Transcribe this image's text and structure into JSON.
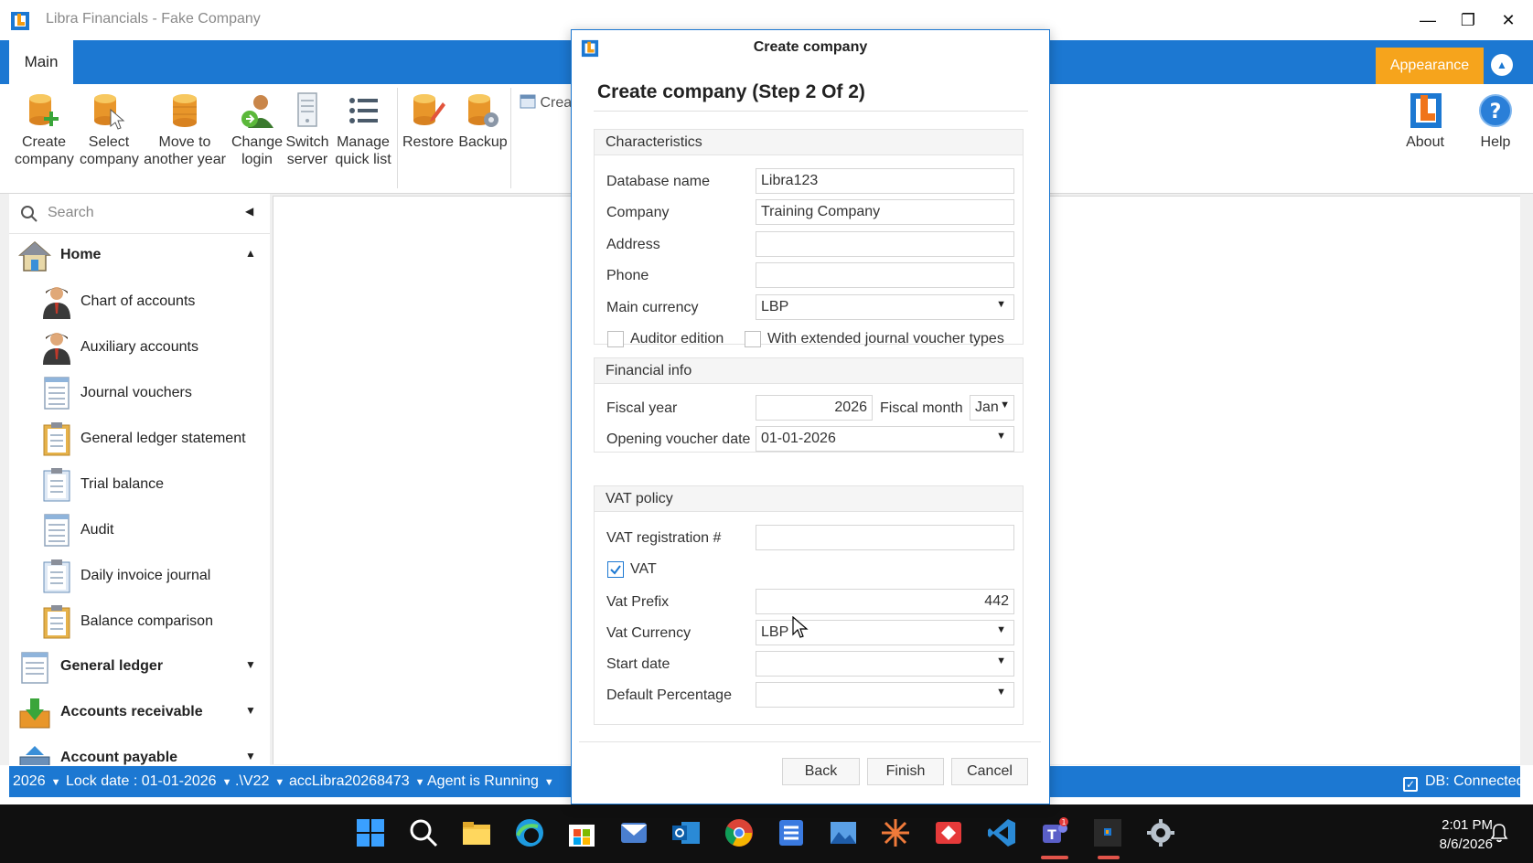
{
  "window": {
    "title": "Libra Financials - Fake Company",
    "minimize": "—",
    "restore": "❐",
    "close": "✕"
  },
  "ribbon": {
    "tab_main": "Main",
    "appearance": "Appearance",
    "collapse": "▲",
    "buttons": [
      {
        "line1": "Create",
        "line2": "company"
      },
      {
        "line1": "Select",
        "line2": "company"
      },
      {
        "line1": "Move to",
        "line2": "another year"
      },
      {
        "line1": "Change",
        "line2": "login"
      },
      {
        "line1": "Switch",
        "line2": "server"
      },
      {
        "line1": "Manage",
        "line2": "quick list"
      },
      {
        "line1": "Restore",
        "line2": ""
      },
      {
        "line1": "Backup",
        "line2": ""
      }
    ],
    "create_small": "Crea",
    "about": "About",
    "help": "Help"
  },
  "sidebar": {
    "search_placeholder": "Search",
    "collapse": "◀",
    "home": {
      "label": "Home",
      "arrow": "▲"
    },
    "items": [
      {
        "label": "Chart of accounts",
        "icon": "person-icon"
      },
      {
        "label": "Auxiliary accounts",
        "icon": "person-icon"
      },
      {
        "label": "Journal vouchers",
        "icon": "document-icon"
      },
      {
        "label": "General ledger statement",
        "icon": "clipboard-icon"
      },
      {
        "label": "Trial balance",
        "icon": "clipboard-icon"
      },
      {
        "label": "Audit",
        "icon": "document-icon"
      },
      {
        "label": "Daily invoice journal",
        "icon": "clipboard-icon"
      },
      {
        "label": "Balance comparison",
        "icon": "clipboard-icon"
      }
    ],
    "groups": [
      {
        "label": "General ledger",
        "arrow": "▼"
      },
      {
        "label": "Accounts receivable",
        "arrow": "▼"
      },
      {
        "label": "Account payable",
        "arrow": "▼"
      }
    ]
  },
  "statusbar": {
    "year": "2026",
    "lock_date": "Lock date : 01-01-2026",
    "server": ".\\V22",
    "database": "accLibra20268473",
    "agent": "Agent is Running",
    "db_status": "DB: Connected",
    "dropdown": "▼",
    "check": "✓"
  },
  "dialog": {
    "title": "Create company",
    "heading": "Create company (Step 2 Of 2)",
    "characteristics": {
      "header": "Characteristics",
      "database_name_label": "Database name",
      "database_name_value": "Libra123",
      "company_label": "Company",
      "company_value": "Training Company",
      "address_label": "Address",
      "address_value": "",
      "phone_label": "Phone",
      "phone_value": "",
      "main_currency_label": "Main currency",
      "main_currency_value": "LBP",
      "auditor_edition_label": "Auditor edition",
      "auditor_edition_checked": false,
      "extended_jv_label": "With extended journal voucher types",
      "extended_jv_checked": false
    },
    "financial": {
      "header": "Financial info",
      "fiscal_year_label": "Fiscal year",
      "fiscal_year_value": "2026",
      "fiscal_month_label": "Fiscal month",
      "fiscal_month_value": "Jan",
      "opening_voucher_label": "Opening voucher date",
      "opening_voucher_value": "01-01-2026"
    },
    "vat": {
      "header": "VAT policy",
      "registration_label": "VAT registration #",
      "registration_value": "",
      "vat_label": "VAT",
      "vat_checked": true,
      "prefix_label": "Vat Prefix",
      "prefix_value": "442",
      "currency_label": "Vat Currency",
      "currency_value": "LBP",
      "start_date_label": "Start date",
      "start_date_value": "",
      "default_pct_label": "Default Percentage",
      "default_pct_value": ""
    },
    "buttons": {
      "back": "Back",
      "finish": "Finish",
      "cancel": "Cancel"
    },
    "dropdown_caret": "▼"
  },
  "taskbar": {
    "time": "2:01 PM",
    "date": "8/6/2026",
    "teams_badge": "1"
  },
  "colors": {
    "accent_blue": "#1c78d2",
    "appearance_orange": "#f6a41c",
    "taskbar": "#101010"
  }
}
